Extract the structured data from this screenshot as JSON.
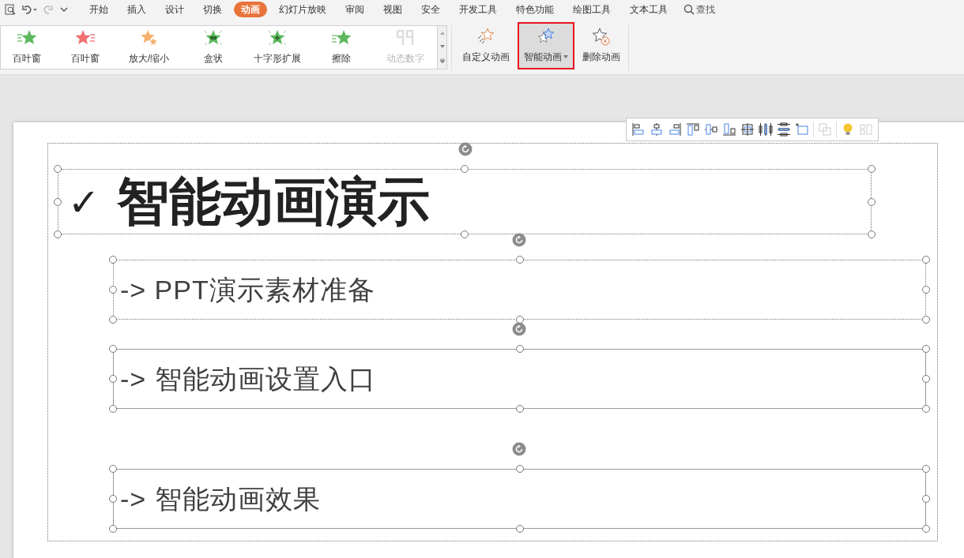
{
  "menu_tabs": [
    {
      "label": "开始",
      "selected": false
    },
    {
      "label": "插入",
      "selected": false
    },
    {
      "label": "设计",
      "selected": false
    },
    {
      "label": "切换",
      "selected": false
    },
    {
      "label": "动画",
      "selected": true
    },
    {
      "label": "幻灯片放映",
      "selected": false
    },
    {
      "label": "审阅",
      "selected": false
    },
    {
      "label": "视图",
      "selected": false
    },
    {
      "label": "安全",
      "selected": false
    },
    {
      "label": "开发工具",
      "selected": false
    },
    {
      "label": "特色功能",
      "selected": false
    },
    {
      "label": "绘图工具",
      "selected": false
    },
    {
      "label": "文本工具",
      "selected": false
    }
  ],
  "search": {
    "label": "查找"
  },
  "effects": [
    {
      "kind": "fly-left",
      "label": "百叶窗",
      "disabled": false
    },
    {
      "kind": "fly-right",
      "label": "百叶窗",
      "disabled": false
    },
    {
      "kind": "zoom",
      "label": "放大/缩小",
      "disabled": false
    },
    {
      "kind": "box",
      "label": "盒状",
      "disabled": false
    },
    {
      "kind": "cross",
      "label": "十字形扩展",
      "disabled": false
    },
    {
      "kind": "wipe",
      "label": "擦除",
      "disabled": false
    },
    {
      "kind": "digits",
      "label": "动态数字",
      "disabled": true
    }
  ],
  "actions": [
    {
      "kind": "custom",
      "label": "自定义动画",
      "highlighted": false,
      "dropdown": false
    },
    {
      "kind": "smart",
      "label": "智能动画",
      "highlighted": true,
      "dropdown": true
    },
    {
      "kind": "delete",
      "label": "删除动画",
      "highlighted": false,
      "dropdown": false
    }
  ],
  "align_tools": [
    {
      "kind": "left",
      "disabled": false
    },
    {
      "kind": "center",
      "disabled": false
    },
    {
      "kind": "right",
      "disabled": false
    },
    {
      "kind": "top",
      "disabled": false
    },
    {
      "kind": "middle",
      "disabled": false
    },
    {
      "kind": "bottom",
      "disabled": false
    },
    {
      "kind": "center-both",
      "disabled": false
    },
    {
      "kind": "distribute-h",
      "disabled": false
    },
    {
      "kind": "distribute-v",
      "disabled": false
    },
    {
      "kind": "fit",
      "disabled": false
    },
    {
      "kind": "group",
      "disabled": true
    },
    {
      "kind": "idea",
      "disabled": false
    },
    {
      "kind": "split",
      "disabled": true
    }
  ],
  "slide": {
    "title": {
      "mark": "✓",
      "text": "智能动画演示"
    },
    "bullets": [
      {
        "text": "-> PPT演示素材准备",
        "selected": true
      },
      {
        "text": "-> 智能动画设置入口",
        "selected": false
      },
      {
        "text": "-> 智能动画效果",
        "selected": false
      }
    ]
  }
}
